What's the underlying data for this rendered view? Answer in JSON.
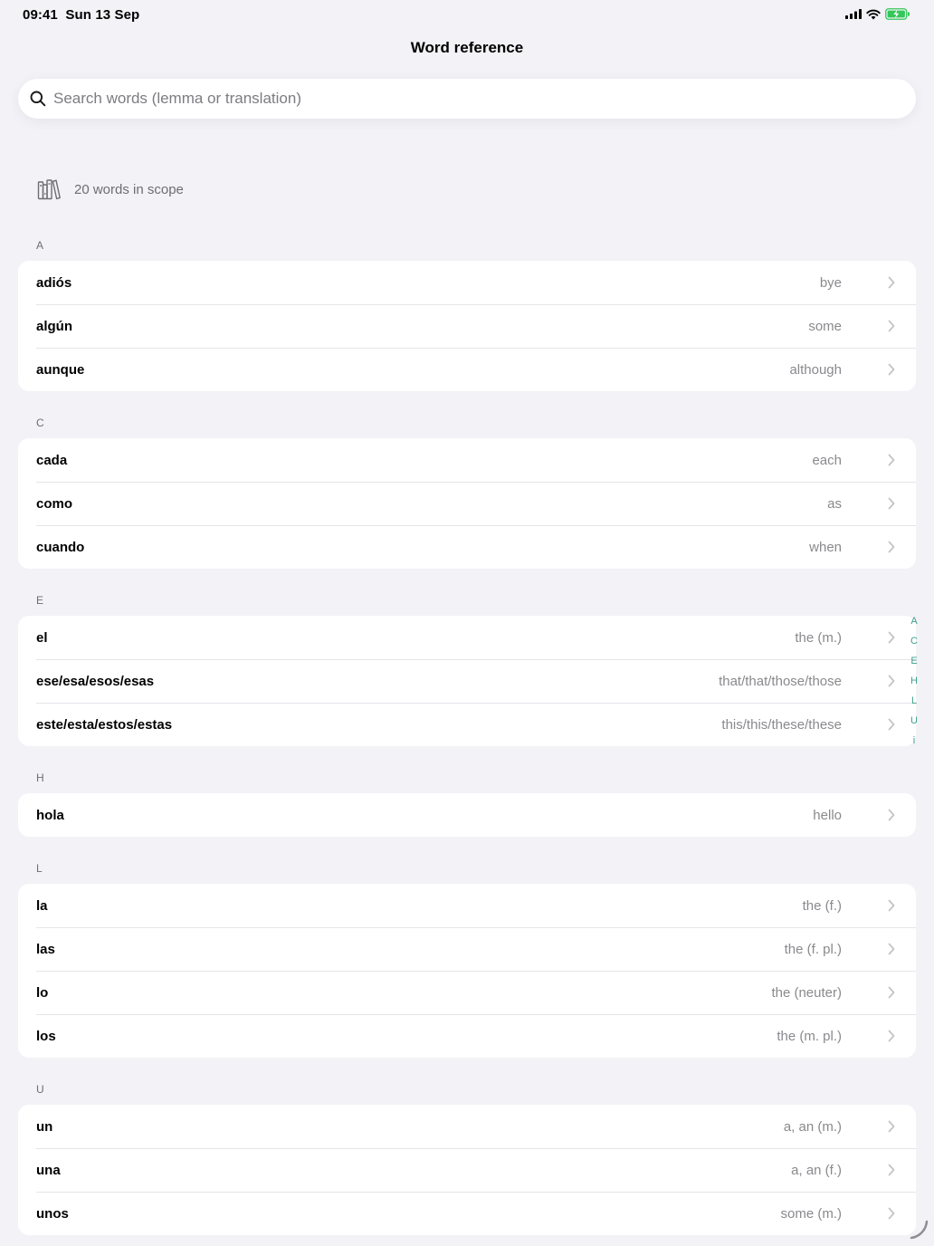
{
  "status_bar": {
    "time": "09:41",
    "date": "Sun 13 Sep"
  },
  "header": {
    "title": "Word reference"
  },
  "search": {
    "placeholder": "Search words (lemma or translation)",
    "value": ""
  },
  "scope": {
    "label": "20 words in scope"
  },
  "colors": {
    "accent": "#3fa08c",
    "battery": "#34c759",
    "background": "#f2f2f7"
  },
  "sections": [
    {
      "letter": "A",
      "words": [
        {
          "lemma": "adiós",
          "translation": "bye"
        },
        {
          "lemma": "algún",
          "translation": "some"
        },
        {
          "lemma": "aunque",
          "translation": "although"
        }
      ]
    },
    {
      "letter": "C",
      "words": [
        {
          "lemma": "cada",
          "translation": "each"
        },
        {
          "lemma": "como",
          "translation": "as"
        },
        {
          "lemma": "cuando",
          "translation": "when"
        }
      ]
    },
    {
      "letter": "E",
      "words": [
        {
          "lemma": "el",
          "translation": "the (m.)"
        },
        {
          "lemma": "ese/esa/esos/esas",
          "translation": "that/that/those/those"
        },
        {
          "lemma": "este/esta/estos/estas",
          "translation": "this/this/these/these"
        }
      ]
    },
    {
      "letter": "H",
      "words": [
        {
          "lemma": "hola",
          "translation": "hello"
        }
      ]
    },
    {
      "letter": "L",
      "words": [
        {
          "lemma": "la",
          "translation": "the (f.)"
        },
        {
          "lemma": "las",
          "translation": "the (f. pl.)"
        },
        {
          "lemma": "lo",
          "translation": "the (neuter)"
        },
        {
          "lemma": "los",
          "translation": "the (m. pl.)"
        }
      ]
    },
    {
      "letter": "U",
      "words": [
        {
          "lemma": "un",
          "translation": "a, an (m.)"
        },
        {
          "lemma": "una",
          "translation": "a, an (f.)"
        },
        {
          "lemma": "unos",
          "translation": "some (m.)"
        }
      ]
    }
  ],
  "index_bar": [
    "A",
    "C",
    "E",
    "H",
    "L",
    "U",
    "i"
  ]
}
